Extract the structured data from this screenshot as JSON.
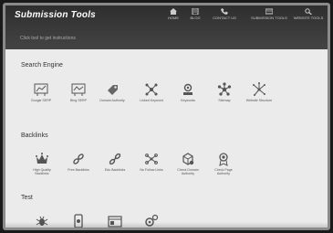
{
  "app": {
    "title": "Submission Tools"
  },
  "nav": [
    {
      "label": "HOME",
      "icon": "home-icon"
    },
    {
      "label": "BLOG",
      "icon": "blog-icon"
    },
    {
      "label": "CONTACT US",
      "icon": "contact-icon"
    },
    {
      "label": "SUBMISSION TOOLS",
      "icon": "tools-icon"
    },
    {
      "label": "WEBSITE TOOLS",
      "icon": "website-tools-icon"
    }
  ],
  "search": {
    "placeholder": "Click tool to get instructions"
  },
  "sections": [
    {
      "title": "Search Engine",
      "tools": [
        {
          "label": "Google SERP",
          "icon": "google-serp-icon"
        },
        {
          "label": "Bing SERP",
          "icon": "bing-serp-icon"
        },
        {
          "label": "Domain Authority",
          "icon": "domain-authority-icon"
        },
        {
          "label": "Linked Keyword",
          "icon": "linked-keyword-icon"
        },
        {
          "label": "Keywords",
          "icon": "keywords-icon"
        },
        {
          "label": "Sitemap",
          "icon": "sitemap-icon"
        },
        {
          "label": "Website Structure",
          "icon": "website-structure-icon"
        }
      ]
    },
    {
      "title": "Backlinks",
      "tools": [
        {
          "label": "High Quality Backlinks",
          "icon": "high-quality-backlinks-icon"
        },
        {
          "label": "Free Backlinks",
          "icon": "free-backlinks-icon"
        },
        {
          "label": "Edu Backlinks",
          "icon": "edu-backlinks-icon"
        },
        {
          "label": "No Follow Links",
          "icon": "nofollow-links-icon"
        },
        {
          "label": "Check Domain Authority",
          "icon": "check-domain-authority-icon"
        },
        {
          "label": "Check Page Authority",
          "icon": "check-page-authority-icon"
        }
      ]
    },
    {
      "title": "Test",
      "tools": [
        {
          "label": "",
          "icon": "bug-icon"
        },
        {
          "label": "",
          "icon": "mobile-test-icon"
        },
        {
          "label": "",
          "icon": "browser-test-icon"
        },
        {
          "label": "",
          "icon": "gears-test-icon"
        }
      ]
    }
  ]
}
